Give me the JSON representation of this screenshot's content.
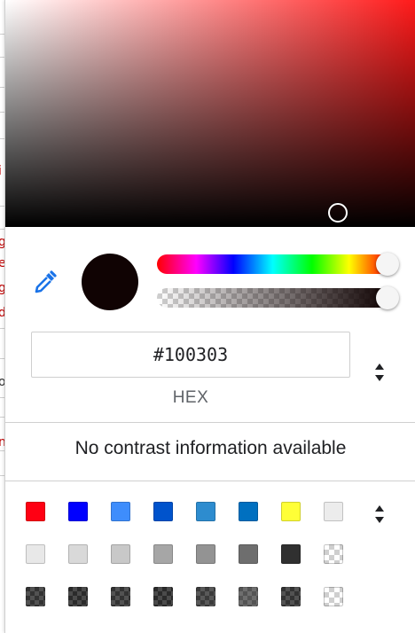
{
  "background_page": {
    "visible_glyphs": [
      {
        "text": "i",
        "color": "#c00000"
      },
      {
        "text": "g",
        "color": "#c00000"
      },
      {
        "text": "e",
        "color": "#c00000"
      },
      {
        "text": "g",
        "color": "#c00000"
      },
      {
        "text": "d",
        "color": "#c00000"
      },
      {
        "text": "o",
        "color": "#333333"
      },
      {
        "text": "n",
        "color": "#c00000"
      }
    ]
  },
  "color_picker": {
    "current_color": "#100303",
    "hue_color": "#ff1a1a",
    "hue_level": 1.0,
    "alpha_level": 1.0,
    "eyedropper_icon": "eyedropper-icon",
    "accent_color": "#1a73e8",
    "hex_value": "#100303",
    "format_label": "HEX",
    "format_toggle_icon": "up-down-arrows-icon",
    "contrast_message": "No contrast information available",
    "palette_toggle_icon": "up-down-arrows-icon",
    "palette": [
      [
        "#ff0013",
        "#0000ff",
        "#3e8dfc",
        "#0053cc",
        "#2d8ccf",
        "#0070c0",
        "#ffff37",
        "#ececec"
      ],
      [
        "#e8e8e8",
        "#d9d9d9",
        "#c8c8c8",
        "#a6a6a6",
        "#939393",
        "#6e6e6e",
        "#303030",
        "transparent"
      ],
      [
        "#333333",
        "#2b2b2b",
        "#333333",
        "#2b2b2b",
        "#3b3b3b",
        "#545454",
        "#333333",
        "transparent"
      ]
    ],
    "palette_semi_transparent_row": 2
  }
}
